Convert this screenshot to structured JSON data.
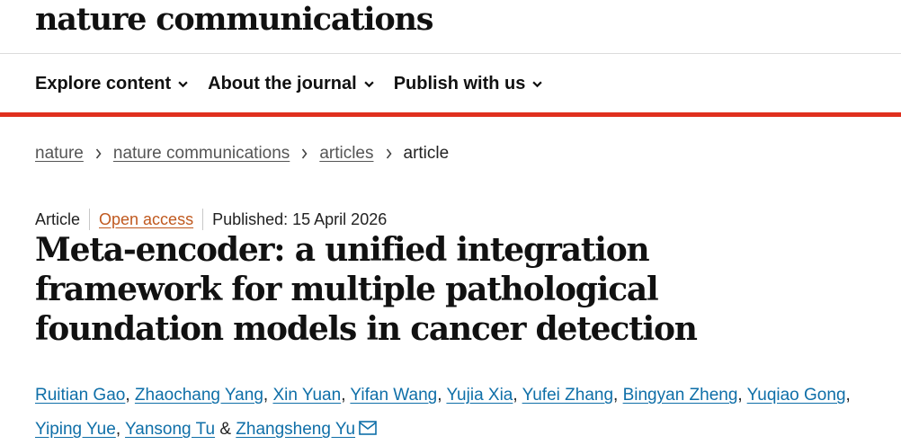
{
  "brand": {
    "logo": "nature communications"
  },
  "nav": {
    "items": [
      {
        "label": "Explore content"
      },
      {
        "label": "About the journal"
      },
      {
        "label": "Publish with us"
      }
    ]
  },
  "breadcrumb": {
    "items": [
      "nature",
      "nature communications",
      "articles"
    ],
    "current": "article"
  },
  "article": {
    "type": "Article",
    "access": "Open access",
    "published": "Published: 15 April 2026",
    "title": "Meta-encoder: a unified integration framework for multiple pathological foundation models in cancer detection",
    "authors": [
      "Ruitian Gao",
      "Zhaochang Yang",
      "Xin Yuan",
      "Yifan Wang",
      "Yujia Xia",
      "Yufei Zhang",
      "Bingyan Zheng",
      "Yuqiao Gong",
      "Yiping Yue",
      "Yansong Tu",
      "Zhangsheng Yu"
    ],
    "author_separator": ", ",
    "author_conjunction": " & "
  },
  "colors": {
    "accent_red": "#e0301e",
    "link_blue": "#0f6fa8",
    "open_access_orange": "#c0591f"
  },
  "icons": {
    "nav_chevron": "chevron-down-icon",
    "breadcrumb_sep": "chevron-right-icon",
    "corresponding": "mail-icon"
  }
}
